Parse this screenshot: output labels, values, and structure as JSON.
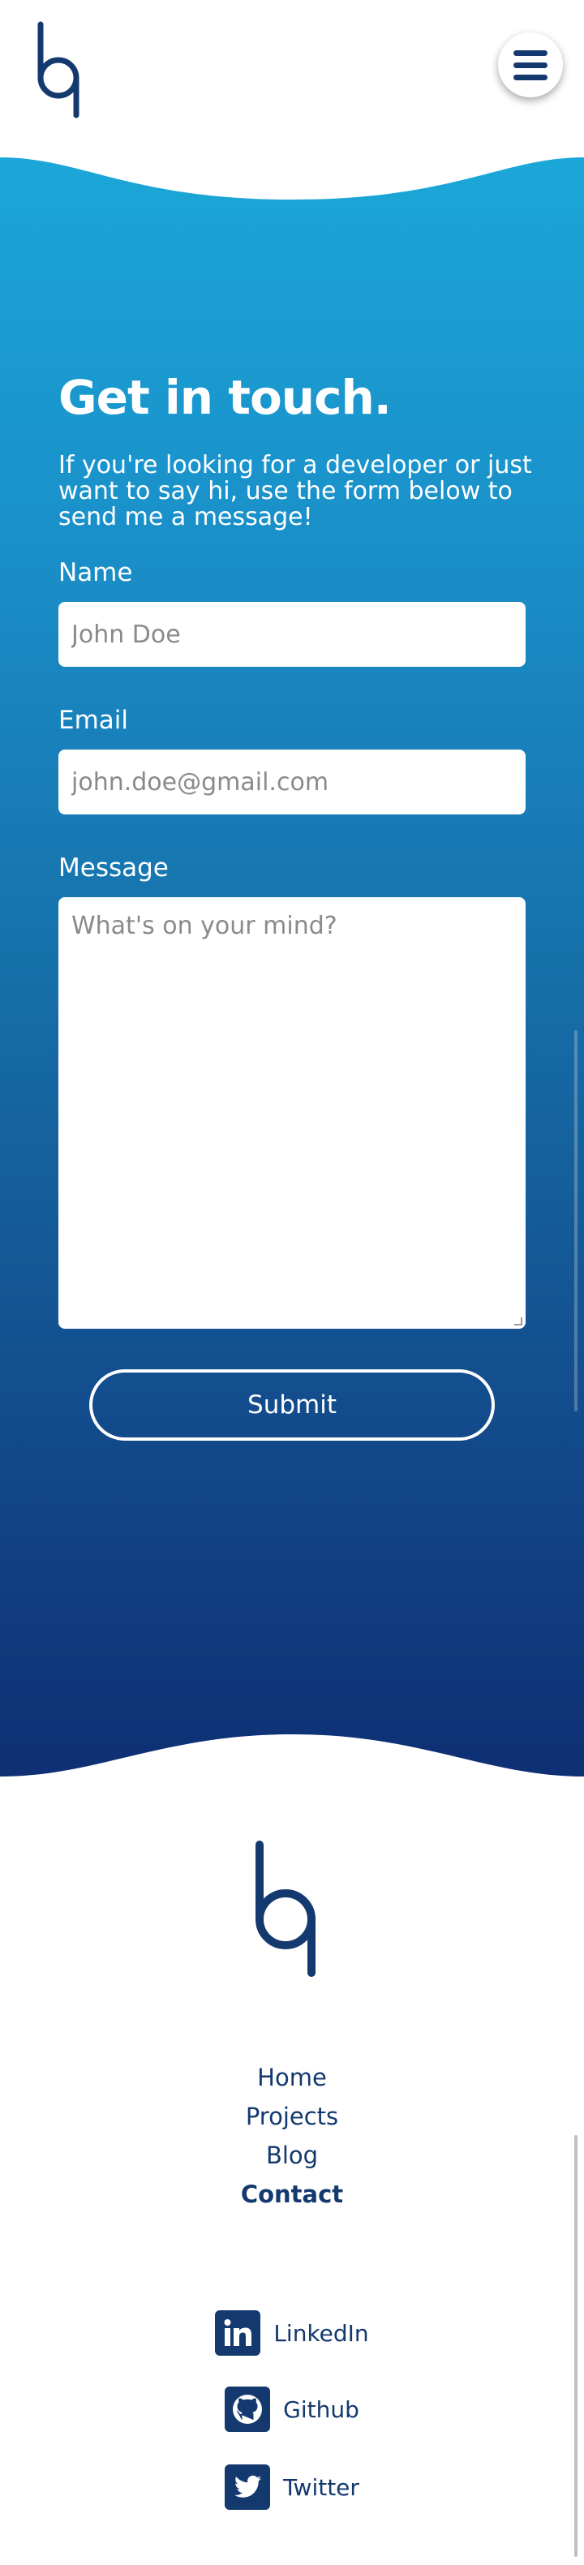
{
  "header": {
    "logo_icon": "bq-logo-icon",
    "menu_icon": "hamburger-menu-icon"
  },
  "contact": {
    "title": "Get in touch.",
    "intro": "If you're looking for a developer or just want to say hi, use the form below to send me a message!",
    "name_label": "Name",
    "name_placeholder": "John Doe",
    "email_label": "Email",
    "email_placeholder": "john.doe@gmail.com",
    "message_label": "Message",
    "message_placeholder": "What's on your mind?",
    "submit_label": "Submit"
  },
  "footer": {
    "logo_icon": "bq-logo-icon",
    "nav": [
      {
        "label": "Home"
      },
      {
        "label": "Projects"
      },
      {
        "label": "Blog"
      },
      {
        "label": "Contact",
        "active": true
      }
    ],
    "social": [
      {
        "label": "LinkedIn",
        "icon": "linkedin-icon"
      },
      {
        "label": "Github",
        "icon": "github-icon"
      },
      {
        "label": "Twitter",
        "icon": "twitter-icon"
      }
    ]
  },
  "colors": {
    "brand": "#14396f",
    "gradient_top": "#1ba7d8",
    "gradient_bottom": "#0e2f74",
    "text_light": "#ffffff"
  }
}
